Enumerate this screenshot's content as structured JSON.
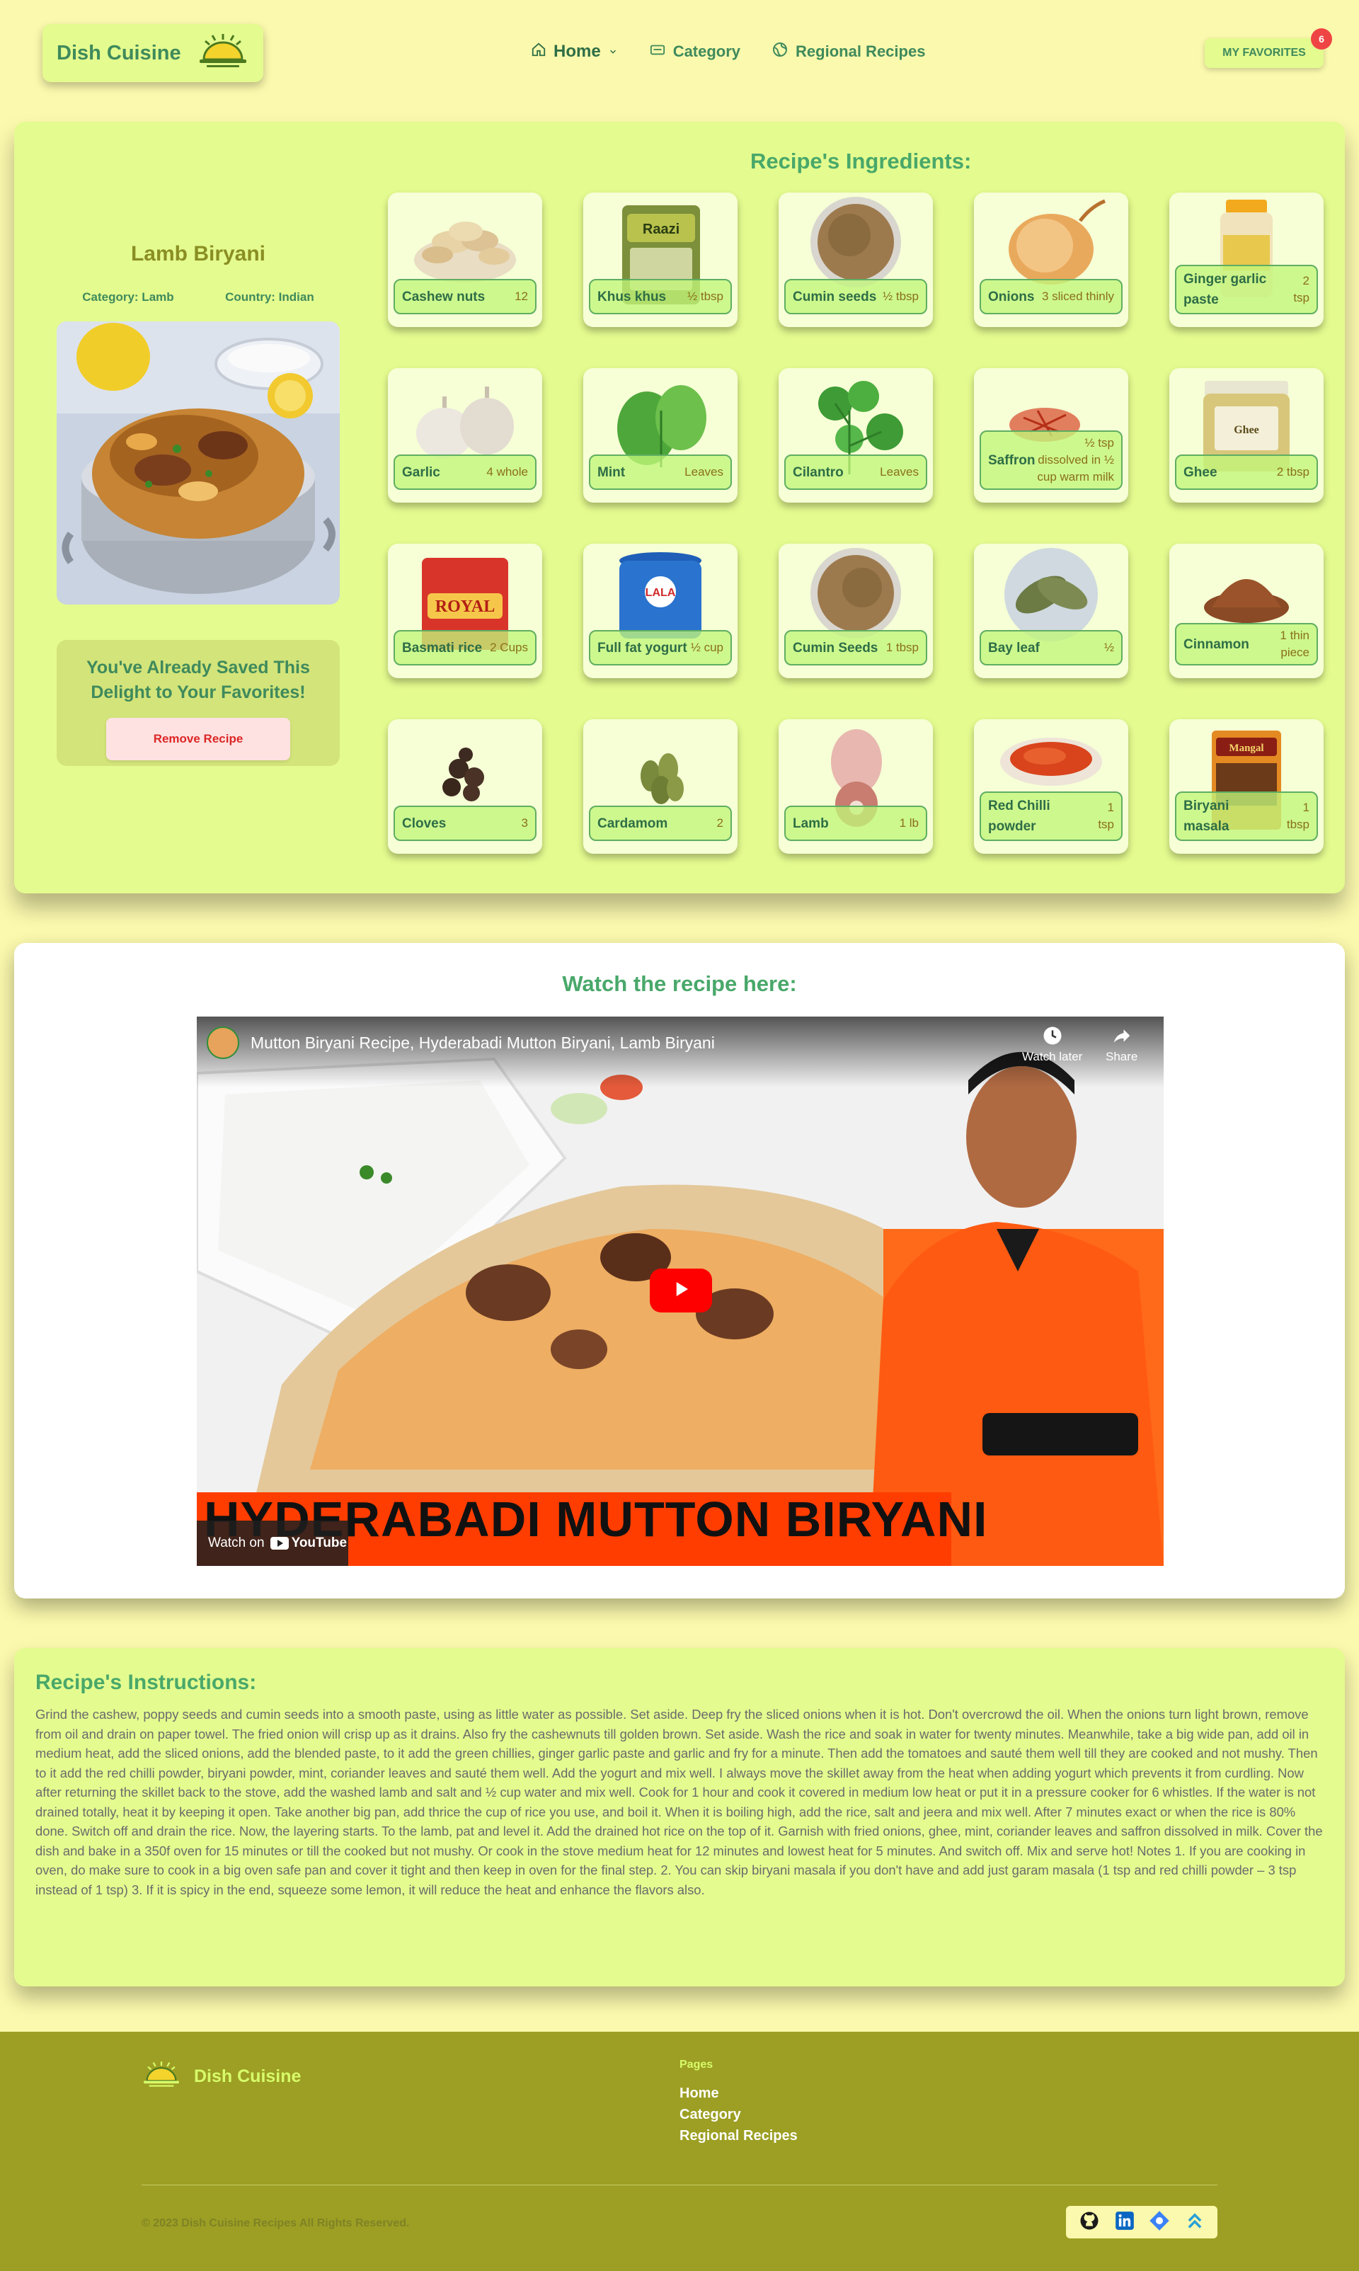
{
  "header": {
    "brand": "Dish Cuisine",
    "nav": [
      {
        "label": "Home",
        "icon": "home-icon"
      },
      {
        "label": "Category",
        "icon": "card-icon"
      },
      {
        "label": "Regional Recipes",
        "icon": "globe-icon"
      }
    ],
    "favorites_label": "MY FAVORITES",
    "favorites_count": "6"
  },
  "recipe": {
    "name": "Lamb Biryani",
    "category": "Category: Lamb",
    "country": "Country: Indian",
    "saved_message": "You've Already Saved This Delight to Your Favorites!",
    "remove_label": "Remove Recipe"
  },
  "ingredients": {
    "title": "Recipe's Ingredients:",
    "items": [
      {
        "name": "Cashew nuts",
        "qty": "12"
      },
      {
        "name": "Khus khus",
        "qty": "½ tbsp"
      },
      {
        "name": "Cumin seeds",
        "qty": "½ tbsp"
      },
      {
        "name": "Onions",
        "qty": "3 sliced thinly"
      },
      {
        "name": "Ginger garlic paste",
        "qty": "2 tsp"
      },
      {
        "name": "Garlic",
        "qty": "4 whole"
      },
      {
        "name": "Mint",
        "qty": "Leaves"
      },
      {
        "name": "Cilantro",
        "qty": "Leaves"
      },
      {
        "name": "Saffron",
        "qty": "½ tsp dissolved in ½ cup warm milk"
      },
      {
        "name": "Ghee",
        "qty": "2 tbsp"
      },
      {
        "name": "Basmati rice",
        "qty": "2 Cups"
      },
      {
        "name": "Full fat yogurt",
        "qty": "½ cup"
      },
      {
        "name": "Cumin Seeds",
        "qty": "1 tbsp"
      },
      {
        "name": "Bay leaf",
        "qty": "½"
      },
      {
        "name": "Cinnamon",
        "qty": "1 thin piece"
      },
      {
        "name": "Cloves",
        "qty": "3"
      },
      {
        "name": "Cardamom",
        "qty": "2"
      },
      {
        "name": "Lamb",
        "qty": "1 lb"
      },
      {
        "name": "Red Chilli powder",
        "qty": "1 tsp"
      },
      {
        "name": "Biryani masala",
        "qty": "1 tbsp"
      }
    ]
  },
  "video": {
    "section_title": "Watch the recipe here:",
    "title": "Mutton Biryani Recipe, Hyderabadi Mutton Biryani, Lamb Biryani",
    "watch_later": "Watch later",
    "share": "Share",
    "banner": "HYDERABADI MUTTON BIRYANI",
    "watch_on": "Watch on",
    "youtube": "YouTube"
  },
  "instructions": {
    "title": "Recipe's Instructions:",
    "text": "Grind the cashew, poppy seeds and cumin seeds into a smooth paste, using as little water as possible. Set aside. Deep fry the sliced onions when it is hot. Don't overcrowd the oil. When the onions turn light brown, remove from oil and drain on paper towel. The fried onion will crisp up as it drains. Also fry the cashewnuts till golden brown. Set aside. Wash the rice and soak in water for twenty minutes. Meanwhile, take a big wide pan, add oil in medium heat, add the sliced onions, add the blended paste, to it add the green chillies, ginger garlic paste and garlic and fry for a minute. Then add the tomatoes and sauté them well till they are cooked and not mushy. Then to it add the red chilli powder, biryani powder, mint, coriander leaves and sauté them well. Add the yogurt and mix well. I always move the skillet away from the heat when adding yogurt which prevents it from curdling. Now after returning the skillet back to the stove, add the washed lamb and salt and ½ cup water and mix well. Cook for 1 hour and cook it covered in medium low heat or put it in a pressure cooker for 6 whistles. If the water is not drained totally, heat it by keeping it open. Take another big pan, add thrice the cup of rice you use, and boil it. When it is boiling high, add the rice, salt and jeera and mix well. After 7 minutes exact or when the rice is 80% done. Switch off and drain the rice. Now, the layering starts. To the lamb, pat and level it. Add the drained hot rice on the top of it. Garnish with fried onions, ghee, mint, coriander leaves and saffron dissolved in milk. Cover the dish and bake in a 350f oven for 15 minutes or till the cooked but not mushy. Or cook in the stove medium heat for 12 minutes and lowest heat for 5 minutes. And switch off. Mix and serve hot! Notes 1. If you are cooking in oven, do make sure to cook in a big oven safe pan and cover it tight and then keep in oven for the final step. 2. You can skip biryani masala if you don't have and add just garam masala (1 tsp and red chilli powder – 3 tsp instead of 1 tsp) 3. If it is spicy in the end, squeeze some lemon, it will reduce the heat and enhance the flavors also."
  },
  "footer": {
    "brand": "Dish Cuisine",
    "pages_title": "Pages",
    "links": [
      "Home",
      "Category",
      "Regional Recipes"
    ],
    "copyright": "© 2023 Dish Cuisine Recipes All Rights Reserved.",
    "socials": [
      "github-icon",
      "linkedin-icon",
      "portfolio-icon",
      "scroll-top-icon"
    ]
  },
  "colors": {
    "page_bg": "#fbf9ad",
    "card_bg": "#e4fb8f",
    "accent_green": "#49a86a",
    "brand_olive": "#8a8f23",
    "footer_bg": "#9c9f23",
    "badge_red": "#ef4444"
  }
}
